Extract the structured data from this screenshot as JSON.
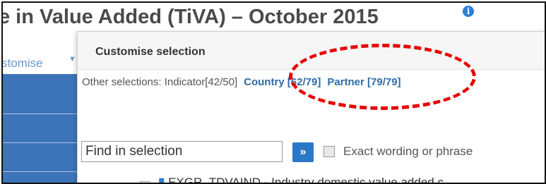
{
  "page": {
    "title": "e in Value Added (TiVA) – October 2015",
    "info_icon_glyph": "i",
    "info_icon": "info-icon"
  },
  "toolbar": {
    "customise_label": "stomise",
    "caret": "▼"
  },
  "panel": {
    "title": "Customise selection",
    "other_selections_label": "Other selections: Indicator[42/50]",
    "links": [
      "Country [62/79]",
      "Partner [79/79]"
    ]
  },
  "search": {
    "value": "Find in selection",
    "go_label": "»",
    "exact_label": "Exact wording or phrase"
  },
  "list": {
    "partial_item": "EXGR_TDVAIND - Industry domestic value added c"
  },
  "colors": {
    "accent": "#2b78c6",
    "sidebar": "#3d74b9",
    "annotation": "#e60000"
  }
}
